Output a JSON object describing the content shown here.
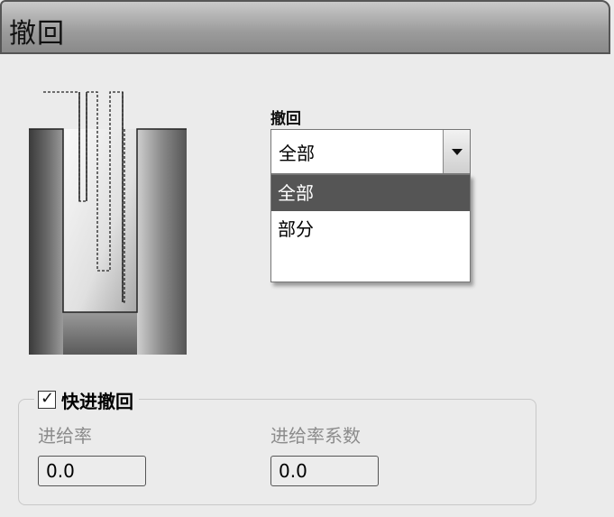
{
  "window": {
    "title": "撤回"
  },
  "retract": {
    "label": "撤回",
    "selected": "全部",
    "options": [
      "全部",
      "部分"
    ],
    "highlighted_index": 0
  },
  "rapid_retract": {
    "label": "快进撤回",
    "checked": true,
    "check_glyph": "✓",
    "feed_rate_label": "进给率",
    "feed_rate_value": "0.0",
    "feed_factor_label": "进给率系数",
    "feed_factor_value": "0.0"
  }
}
